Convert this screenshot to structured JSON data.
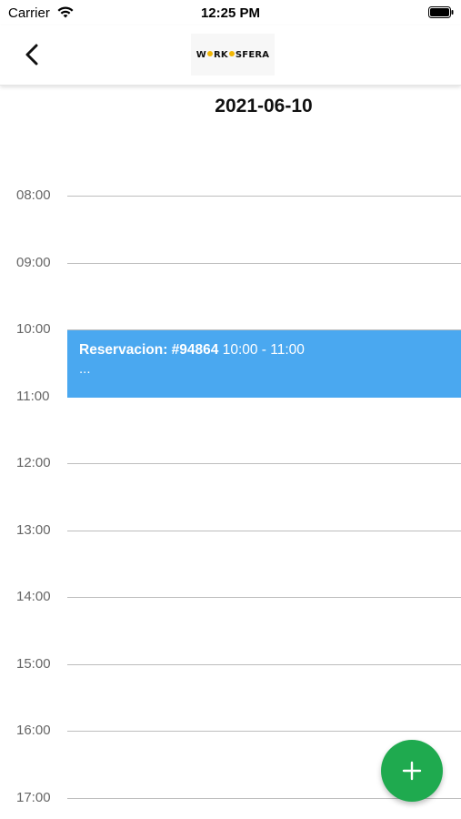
{
  "status_bar": {
    "carrier": "Carrier",
    "time": "12:25 PM"
  },
  "nav": {
    "back_icon": "chevron-left-icon",
    "logo_text_before": "W",
    "logo_text_after": "RK",
    "logo_text_end": "SFERA",
    "logo_accent_color": "#f2b705"
  },
  "date": "2021-06-10",
  "schedule": {
    "hours": [
      "08:00",
      "09:00",
      "10:00",
      "11:00",
      "12:00",
      "13:00",
      "14:00",
      "15:00",
      "16:00",
      "17:00"
    ]
  },
  "event": {
    "title": "Reservacion: #94864",
    "time_range": "10:00 - 11:00",
    "description": "...",
    "color": "#4aa8f0"
  },
  "fab": {
    "icon": "plus-icon",
    "label": "+",
    "color": "#1faa4f"
  }
}
